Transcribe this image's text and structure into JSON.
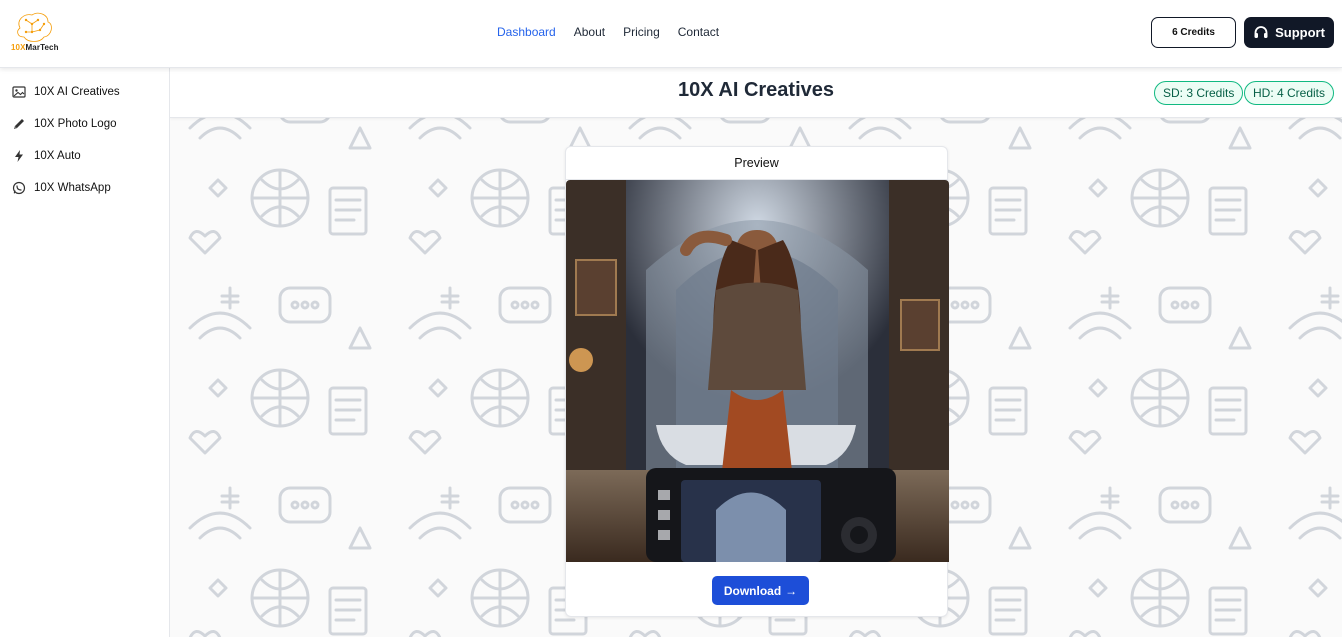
{
  "brand": {
    "name_prefix": "10X",
    "name_suffix": "MarTech"
  },
  "nav": {
    "items": [
      {
        "label": "Dashboard",
        "active": true
      },
      {
        "label": "About",
        "active": false
      },
      {
        "label": "Pricing",
        "active": false
      },
      {
        "label": "Contact",
        "active": false
      }
    ]
  },
  "header": {
    "credits_label": "6 Credits",
    "support_label": "Support"
  },
  "sidebar": {
    "items": [
      {
        "label": "10X AI Creatives",
        "icon": "image-icon"
      },
      {
        "label": "10X Photo Logo",
        "icon": "pencil-icon"
      },
      {
        "label": "10X Auto",
        "icon": "lightning-icon"
      },
      {
        "label": "10X WhatsApp",
        "icon": "whatsapp-icon"
      }
    ]
  },
  "main": {
    "title": "10X AI Creatives",
    "badges": {
      "sd": "SD: 3 Credits",
      "hd": "HD: 4 Credits"
    },
    "card": {
      "header": "Preview",
      "download_label": "Download"
    }
  },
  "colors": {
    "accent": "#2563eb",
    "dark": "#111827",
    "download": "#1d4ed8",
    "badge_border": "#10b981",
    "logo_orange": "#f59e0b"
  }
}
